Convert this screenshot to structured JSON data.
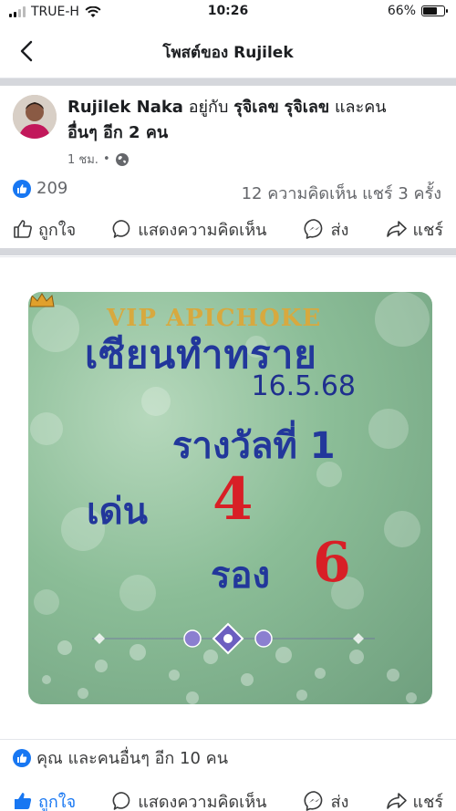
{
  "status_bar": {
    "carrier": "TRUE-H",
    "time": "10:26",
    "battery": "66%",
    "battery_level": 0.66
  },
  "nav": {
    "title": "โพสต์ของ Rujilek"
  },
  "post": {
    "author": "Rujilek Naka",
    "with_text": " อยู่กับ ",
    "tagged_1": "รุจิเลข",
    "tagged_2": "รุจิเลข",
    "and_text": " และคน",
    "others": "อื่นๆ อีก 2 คน",
    "time": "1 ชม.",
    "separator": "•",
    "privacy_icon": "globe-icon"
  },
  "counts": {
    "likes": "209",
    "comments_shares": "12 ความคิดเห็น  แชร์ 3 ครั้ง"
  },
  "actions": {
    "like": "ถูกใจ",
    "comment": "แสดงความคิดเห็น",
    "send": "ส่ง",
    "share": "แชร์"
  },
  "image": {
    "watermark": "VIP APICHOKE",
    "headline": "เซียนทำทราย",
    "date": "16.5.68",
    "prize": "รางวัลที่ 1",
    "lead_label": "เด่น",
    "lead_number": "4",
    "second_label": "รอง",
    "second_number": "6"
  },
  "footer": {
    "reactions": "คุณ และคนอื่นๆ อีก 10 คน"
  },
  "colors": {
    "accent": "#1877f2",
    "headline_blue": "#22379b",
    "number_red": "#d81f26"
  }
}
